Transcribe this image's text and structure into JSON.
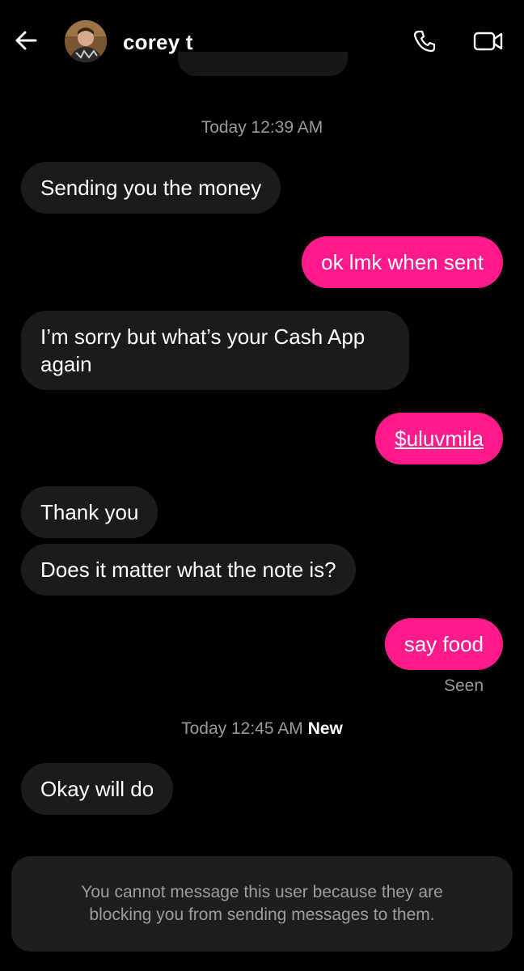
{
  "header": {
    "contact_name": "corey t",
    "back_icon": "arrow-left-icon",
    "call_icon": "phone-icon",
    "video_icon": "video-camera-icon"
  },
  "colors": {
    "background": "#000000",
    "incoming_bubble": "#1b1b1b",
    "outgoing_bubble": "#ff1a8c",
    "muted_text": "#9a9a9a"
  },
  "timestamps": [
    {
      "text": "Today 12:39 AM",
      "badge": ""
    },
    {
      "text": "Today 12:45 AM",
      "badge": "New"
    }
  ],
  "messages": [
    {
      "direction": "incoming",
      "text": "Sending you the money"
    },
    {
      "direction": "outgoing",
      "text": "ok lmk when sent"
    },
    {
      "direction": "incoming",
      "text": "I’m sorry but what’s your Cash App again"
    },
    {
      "direction": "outgoing",
      "text": "$uluvmila",
      "is_link": true
    },
    {
      "direction": "incoming",
      "text": "Thank you"
    },
    {
      "direction": "incoming",
      "text": "Does it matter what the note is?"
    },
    {
      "direction": "outgoing",
      "text": "say food"
    },
    {
      "direction": "incoming",
      "text": "Okay will do"
    }
  ],
  "status": {
    "seen": "Seen"
  },
  "blocked_notice": "You cannot message this user because they are blocking you from sending messages to them."
}
